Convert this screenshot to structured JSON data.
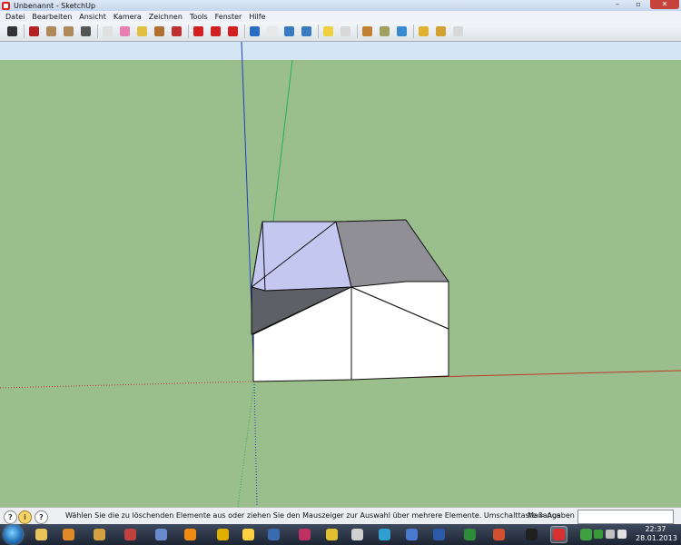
{
  "window": {
    "title": "Unbenannt - SketchUp",
    "buttons": [
      "–",
      "▫",
      "✕"
    ]
  },
  "menu": [
    "Datei",
    "Bearbeiten",
    "Ansicht",
    "Kamera",
    "Zeichnen",
    "Tools",
    "Fenster",
    "Hilfe"
  ],
  "toolbar": {
    "tools": [
      {
        "name": "select-tool-icon",
        "color": "#333333"
      },
      {
        "name": "line-tool-icon",
        "color": "#b22222"
      },
      {
        "name": "rectangle-tool-icon",
        "color": "#b08a5a"
      },
      {
        "name": "circle-tool-icon",
        "color": "#b08a5a"
      },
      {
        "name": "arc-tool-icon",
        "color": "#555555"
      },
      {
        "name": "make-component-icon",
        "color": "#e0e0e0"
      },
      {
        "name": "eraser-tool-icon",
        "color": "#e87fb0"
      },
      {
        "name": "tape-measure-icon",
        "color": "#e0c040"
      },
      {
        "name": "paint-bucket-icon",
        "color": "#b07030"
      },
      {
        "name": "push-pull-icon",
        "color": "#c03030"
      },
      {
        "name": "move-tool-icon",
        "color": "#d02020"
      },
      {
        "name": "rotate-tool-icon",
        "color": "#d02020"
      },
      {
        "name": "offset-tool-icon",
        "color": "#d02020"
      },
      {
        "name": "orbit-tool-icon",
        "color": "#2a6cc4"
      },
      {
        "name": "pan-tool-icon",
        "color": "#e8e8e8"
      },
      {
        "name": "zoom-tool-icon",
        "color": "#3a7ac0"
      },
      {
        "name": "zoom-extents-icon",
        "color": "#3a7ac0"
      },
      {
        "name": "get-models-icon",
        "color": "#f0d040"
      },
      {
        "name": "share-model-icon",
        "color": "#d8d8d8"
      },
      {
        "name": "add-location-icon",
        "color": "#c08030"
      },
      {
        "name": "toggle-terrain-icon",
        "color": "#a0a060"
      },
      {
        "name": "google-earth-icon",
        "color": "#3a8ad0"
      },
      {
        "name": "get-components-icon",
        "color": "#e0b030"
      },
      {
        "name": "share-component-icon",
        "color": "#d0a030"
      },
      {
        "name": "extension-warehouse-icon",
        "color": "#d8d8d8"
      }
    ]
  },
  "status": {
    "message": "Wählen Sie die zu löschenden Elemente aus oder ziehen Sie den Mauszeiger zur Auswahl über mehrere Elemente. Umschalttaste = Aus",
    "measurements_label": "Maßangaben",
    "measurements_value": ""
  },
  "scene": {
    "sky_color": "#d3e6f4",
    "ground_color": "#9bbf8c",
    "axis_colors": {
      "red": "#c0392b",
      "green": "#27ae60",
      "blue": "#2040c0"
    },
    "face_colors": {
      "light_roof": "#c4c8f0",
      "dark_roof": "#8f8f95",
      "wall": "#ffffff",
      "shadow": "#5f5f68"
    }
  },
  "taskbar": {
    "apps": [
      {
        "name": "windows-explorer-icon",
        "color": "#e7c35a",
        "active": false
      },
      {
        "name": "firefox-icon",
        "color": "#e08a2a",
        "active": false
      },
      {
        "name": "app-icon-3",
        "color": "#d4a040",
        "active": false
      },
      {
        "name": "app-icon-4",
        "color": "#c04040",
        "active": false
      },
      {
        "name": "media-player-icon",
        "color": "#6a8ad0",
        "active": false
      },
      {
        "name": "vlc-icon",
        "color": "#f08a10",
        "active": false
      },
      {
        "name": "app-icon-7",
        "color": "#e0b000",
        "active": false
      },
      {
        "name": "app-icon-8",
        "color": "#ffd040",
        "active": false
      },
      {
        "name": "pd-icon",
        "color": "#3a6ab0",
        "active": false
      },
      {
        "name": "app-icon-10",
        "color": "#c03060",
        "active": false
      },
      {
        "name": "app-icon-11",
        "color": "#e0c030",
        "active": false
      },
      {
        "name": "app-icon-12",
        "color": "#d0d0d0",
        "active": false
      },
      {
        "name": "app-icon-13",
        "color": "#30a0d0",
        "active": false
      },
      {
        "name": "app-icon-14",
        "color": "#4a7ad0",
        "active": false
      },
      {
        "name": "word-icon",
        "color": "#2b5aa8",
        "active": false
      },
      {
        "name": "excel-icon",
        "color": "#2f8a3a",
        "active": false
      },
      {
        "name": "app-icon-17",
        "color": "#d05030",
        "active": false
      },
      {
        "name": "terminal-icon",
        "color": "#202020",
        "active": false
      },
      {
        "name": "sketchup-icon",
        "color": "#d83030",
        "active": true
      },
      {
        "name": "app-icon-20",
        "color": "#40a040",
        "active": false
      }
    ],
    "clock_time": "22:37",
    "clock_date": "28.01.2013"
  }
}
